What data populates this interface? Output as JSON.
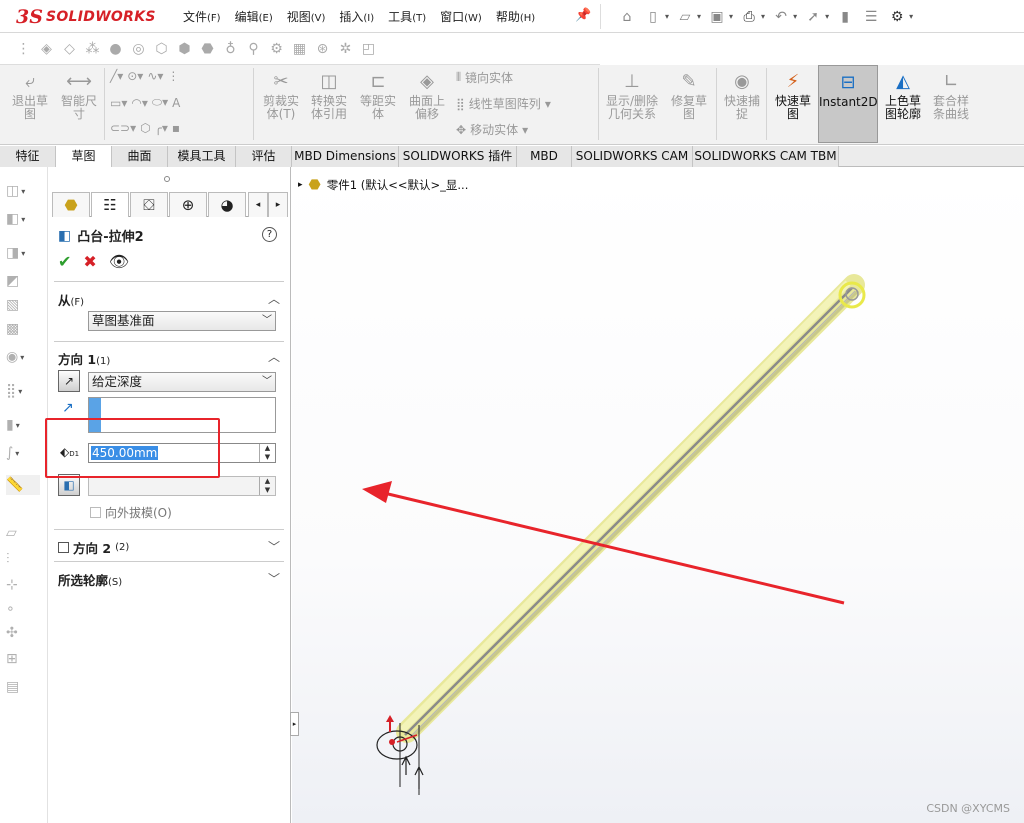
{
  "app": {
    "logo_ds": "3S",
    "logo_name": "SOLIDWORKS"
  },
  "menu": [
    {
      "label": "文件",
      "key": "(F)"
    },
    {
      "label": "编辑",
      "key": "(E)"
    },
    {
      "label": "视图",
      "key": "(V)"
    },
    {
      "label": "插入",
      "key": "(I)"
    },
    {
      "label": "工具",
      "key": "(T)"
    },
    {
      "label": "窗口",
      "key": "(W)"
    },
    {
      "label": "帮助",
      "key": "(H)"
    }
  ],
  "ribbon": {
    "exit_sketch": "退出草图",
    "smart_dim": "智能尺寸",
    "trim": "剪裁实体(T)",
    "convert": "转换实体引用",
    "offset": "等距实体",
    "surface_offset": "曲面上偏移",
    "mirror": "镜向实体",
    "linear_pattern": "线性草图阵列",
    "move": "移动实体",
    "show_delete_rel": "显示/删除几何关系",
    "repair": "修复草图",
    "quick_snap": "快速捕捉",
    "quick_sketch": "快速草图",
    "instant2d": "Instant2D",
    "shaded_sketch": "上色草图轮廓",
    "fit_spline": "套合样条曲线"
  },
  "tabs": [
    "特征",
    "草图",
    "曲面",
    "模具工具",
    "评估",
    "MBD Dimensions",
    "SOLIDWORKS 插件",
    "MBD",
    "SOLIDWORKS CAM",
    "SOLIDWORKS CAM TBM"
  ],
  "active_tab": "草图",
  "property_manager": {
    "title": "凸台-拉伸2",
    "help": "?",
    "from": {
      "header": "从",
      "key": "(F)",
      "value": "草图基准面"
    },
    "direction1": {
      "header": "方向 1",
      "key": "(1)",
      "end_condition": "给定深度",
      "depth": "450.00mm",
      "draft_outward": "向外拔模(O)"
    },
    "direction2": {
      "header": "方向 2",
      "key": "(2)"
    },
    "selected_contours": {
      "header": "所选轮廓",
      "key": "(S)"
    }
  },
  "feature_tree": {
    "root": "零件1  (默认<<默认>_显..."
  },
  "annotation": {
    "color": "#e8242b"
  },
  "model": {
    "color": "#eef0a8"
  },
  "watermark": "CSDN @XYCMS"
}
